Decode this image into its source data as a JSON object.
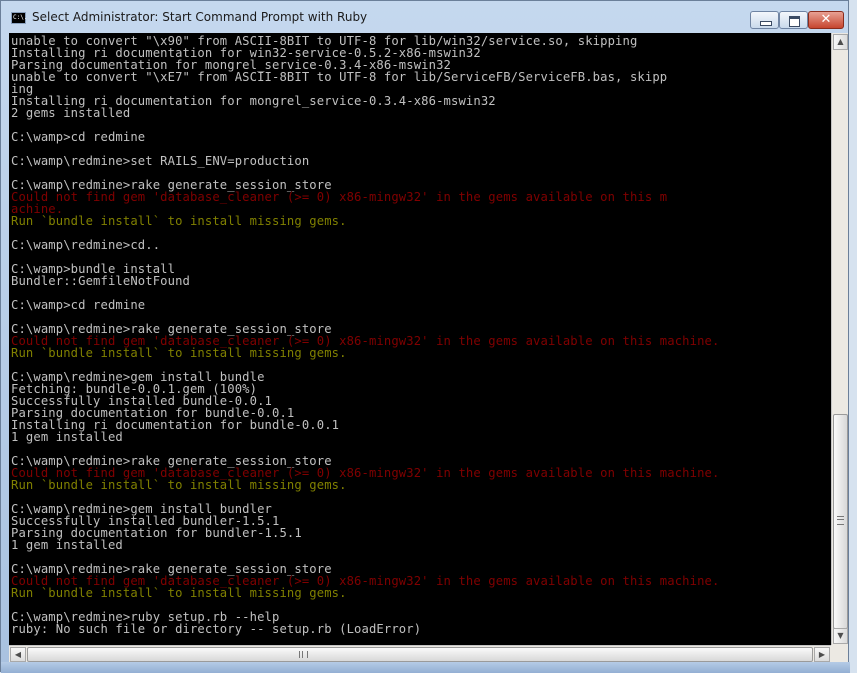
{
  "window": {
    "title": "Select Administrator: Start Command Prompt with Ruby",
    "icon_label": "C:\\."
  },
  "controls": {
    "minimize_icon": "minimize-icon",
    "maximize_icon": "maximize-icon",
    "close_glyph": "✕"
  },
  "console": {
    "lines": [
      {
        "text": "unable to convert \"\\x90\" from ASCII-8BIT to UTF-8 for lib/win32/service.so, skipping",
        "color": "white"
      },
      {
        "text": "Installing ri documentation for win32-service-0.5.2-x86-mswin32",
        "color": "white"
      },
      {
        "text": "Parsing documentation for mongrel_service-0.3.4-x86-mswin32",
        "color": "white"
      },
      {
        "text": "unable to convert \"\\xE7\" from ASCII-8BIT to UTF-8 for lib/ServiceFB/ServiceFB.bas, skipp",
        "color": "white"
      },
      {
        "text": "ing",
        "color": "white"
      },
      {
        "text": "Installing ri documentation for mongrel_service-0.3.4-x86-mswin32",
        "color": "white"
      },
      {
        "text": "2 gems installed",
        "color": "white"
      },
      {
        "text": "",
        "color": "white"
      },
      {
        "text": "C:\\wamp>cd redmine",
        "color": "white"
      },
      {
        "text": "",
        "color": "white"
      },
      {
        "text": "C:\\wamp\\redmine>set RAILS_ENV=production",
        "color": "white"
      },
      {
        "text": "",
        "color": "white"
      },
      {
        "text": "C:\\wamp\\redmine>rake generate_session_store",
        "color": "white"
      },
      {
        "text": "Could not find gem 'database_cleaner (>= 0) x86-mingw32' in the gems available on this m",
        "color": "red"
      },
      {
        "text": "achine.",
        "color": "red"
      },
      {
        "text": "Run `bundle install` to install missing gems.",
        "color": "yellow"
      },
      {
        "text": "",
        "color": "white"
      },
      {
        "text": "C:\\wamp\\redmine>cd..",
        "color": "white"
      },
      {
        "text": "",
        "color": "white"
      },
      {
        "text": "C:\\wamp>bundle install",
        "color": "white"
      },
      {
        "text": "Bundler::GemfileNotFound",
        "color": "white"
      },
      {
        "text": "",
        "color": "white"
      },
      {
        "text": "C:\\wamp>cd redmine",
        "color": "white"
      },
      {
        "text": "",
        "color": "white"
      },
      {
        "text": "C:\\wamp\\redmine>rake generate_session_store",
        "color": "white"
      },
      {
        "text": "Could not find gem 'database_cleaner (>= 0) x86-mingw32' in the gems available on this machine.",
        "color": "red"
      },
      {
        "text": "Run `bundle install` to install missing gems.",
        "color": "yellow"
      },
      {
        "text": "",
        "color": "white"
      },
      {
        "text": "C:\\wamp\\redmine>gem install bundle",
        "color": "white"
      },
      {
        "text": "Fetching: bundle-0.0.1.gem (100%)",
        "color": "white"
      },
      {
        "text": "Successfully installed bundle-0.0.1",
        "color": "white"
      },
      {
        "text": "Parsing documentation for bundle-0.0.1",
        "color": "white"
      },
      {
        "text": "Installing ri documentation for bundle-0.0.1",
        "color": "white"
      },
      {
        "text": "1 gem installed",
        "color": "white"
      },
      {
        "text": "",
        "color": "white"
      },
      {
        "text": "C:\\wamp\\redmine>rake generate_session_store",
        "color": "white"
      },
      {
        "text": "Could not find gem 'database_cleaner (>= 0) x86-mingw32' in the gems available on this machine.",
        "color": "red"
      },
      {
        "text": "Run `bundle install` to install missing gems.",
        "color": "yellow"
      },
      {
        "text": "",
        "color": "white"
      },
      {
        "text": "C:\\wamp\\redmine>gem install bundler",
        "color": "white"
      },
      {
        "text": "Successfully installed bundler-1.5.1",
        "color": "white"
      },
      {
        "text": "Parsing documentation for bundler-1.5.1",
        "color": "white"
      },
      {
        "text": "1 gem installed",
        "color": "white"
      },
      {
        "text": "",
        "color": "white"
      },
      {
        "text": "C:\\wamp\\redmine>rake generate_session_store",
        "color": "white"
      },
      {
        "text": "Could not find gem 'database_cleaner (>= 0) x86-mingw32' in the gems available on this machine.",
        "color": "red"
      },
      {
        "text": "Run `bundle install` to install missing gems.",
        "color": "yellow"
      },
      {
        "text": "",
        "color": "white"
      },
      {
        "text": "C:\\wamp\\redmine>ruby setup.rb --help",
        "color": "white"
      },
      {
        "text": "ruby: No such file or directory -- setup.rb (LoadError)",
        "color": "white"
      }
    ]
  },
  "colors": {
    "console_bg": "#000000",
    "default_text": "#c0c0c0",
    "error_text": "#800000",
    "hint_text": "#808000"
  },
  "scrollbars": {
    "up_arrow": "▲",
    "down_arrow": "▼",
    "left_arrow": "◀",
    "right_arrow": "▶"
  }
}
